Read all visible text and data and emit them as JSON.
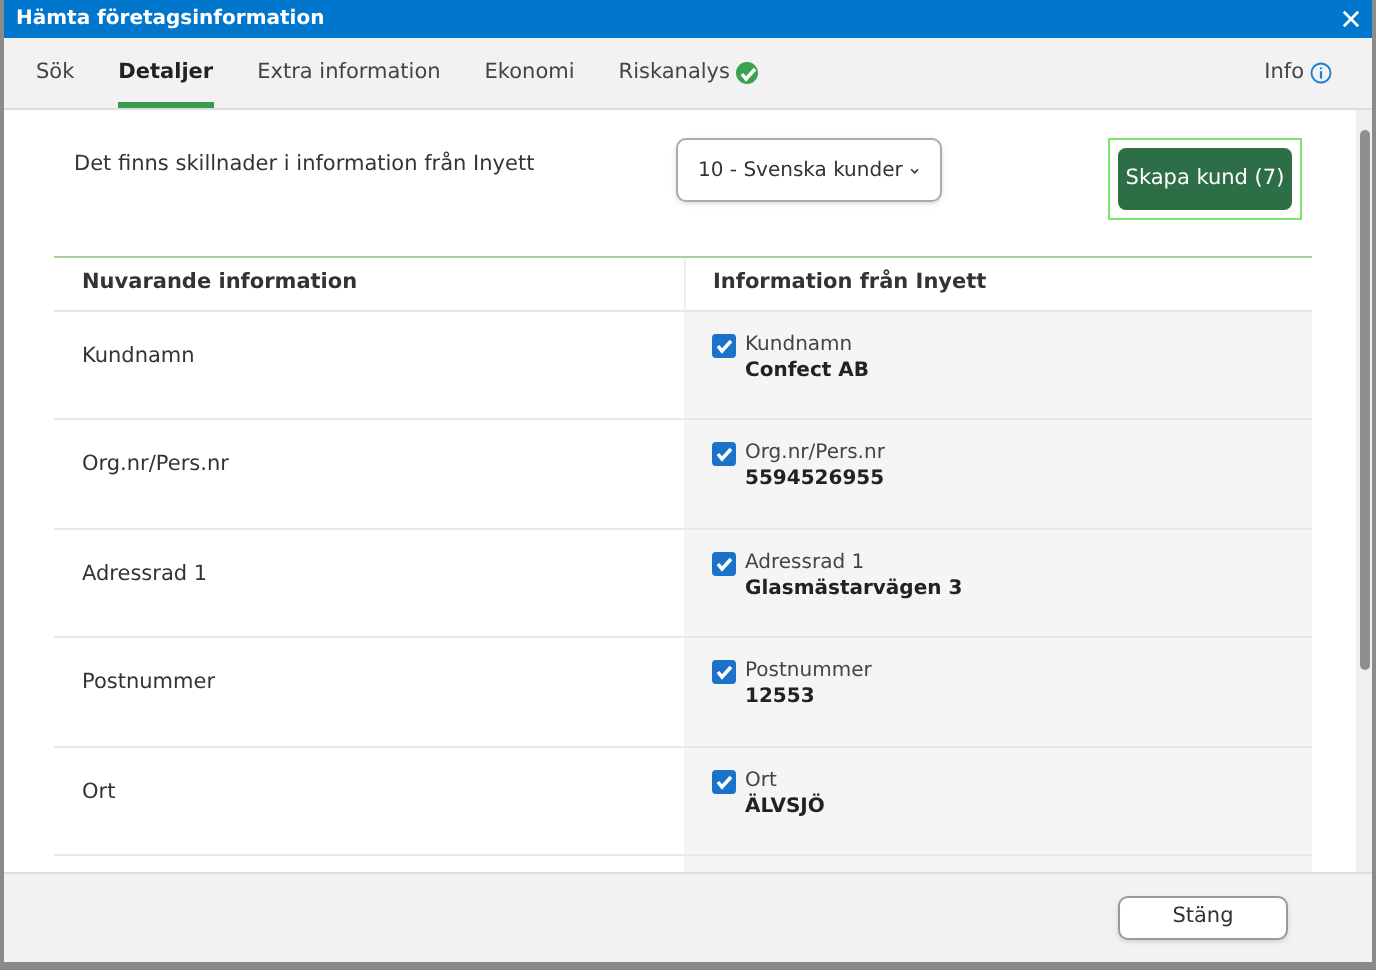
{
  "window": {
    "title": "Hämta företagsinformation"
  },
  "tabs": [
    {
      "label": "Sök",
      "selected": false,
      "checked": false
    },
    {
      "label": "Detaljer",
      "selected": true,
      "checked": false
    },
    {
      "label": "Extra information",
      "selected": false,
      "checked": false
    },
    {
      "label": "Ekonomi",
      "selected": false,
      "checked": false
    },
    {
      "label": "Riskanalys",
      "selected": false,
      "checked": true
    }
  ],
  "info_link": "Info",
  "message": "Det finns skillnader i information från Inyett",
  "dropdown": {
    "value": "10 - Svenska kunder"
  },
  "create_button": "Skapa kund (7)",
  "table": {
    "columns": [
      "Nuvarande information",
      "Information från Inyett"
    ],
    "rows": [
      {
        "current": "Kundnamn",
        "field": "Kundnamn",
        "value": "Confect AB",
        "checked": true
      },
      {
        "current": "Org.nr/Pers.nr",
        "field": "Org.nr/Pers.nr",
        "value": "5594526955",
        "checked": true
      },
      {
        "current": "Adressrad 1",
        "field": "Adressrad 1",
        "value": "Glasmästarvägen 3",
        "checked": true
      },
      {
        "current": "Postnummer",
        "field": "Postnummer",
        "value": "12553",
        "checked": true
      },
      {
        "current": "Ort",
        "field": "Ort",
        "value": "ÄLVSJÖ",
        "checked": true
      }
    ]
  },
  "close_button": "Stäng"
}
